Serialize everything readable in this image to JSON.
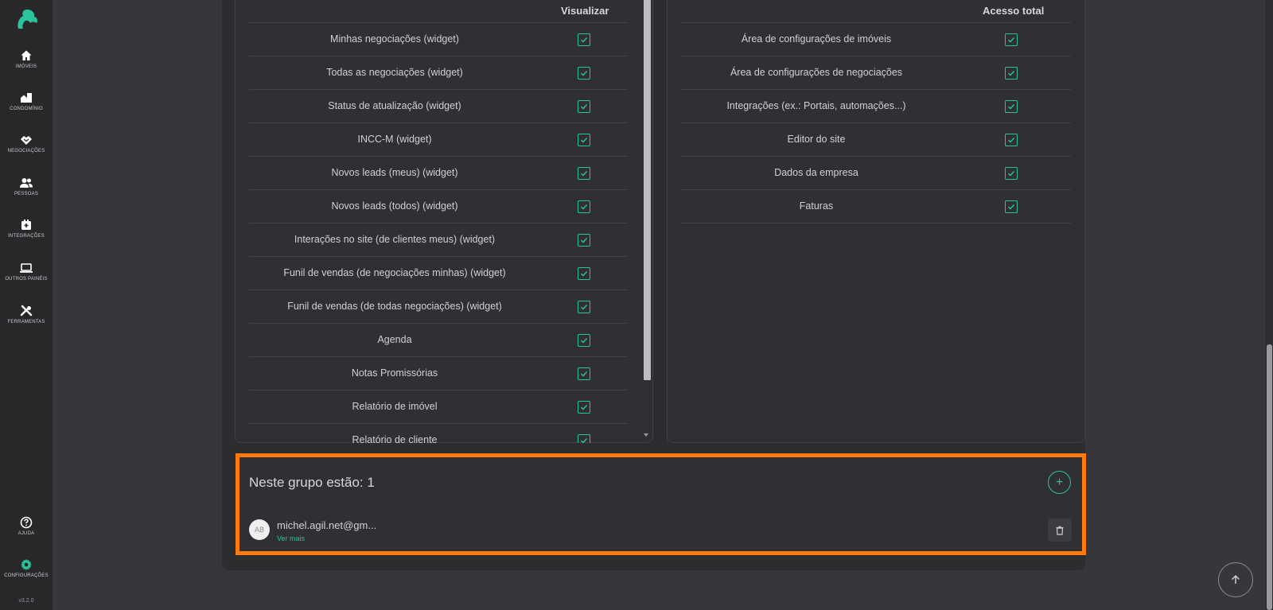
{
  "sidebar": {
    "items": [
      {
        "label": "IMÓVEIS",
        "icon": "home-icon"
      },
      {
        "label": "CONDOMÍNIO",
        "icon": "building-icon"
      },
      {
        "label": "NEGOCIAÇÕES",
        "icon": "handshake-icon"
      },
      {
        "label": "PESSOAS",
        "icon": "people-icon"
      },
      {
        "label": "INTEGRAÇÕES",
        "icon": "integrations-icon"
      },
      {
        "label": "OUTROS PAINÉIS",
        "icon": "laptop-icon"
      },
      {
        "label": "FERRAMENTAS",
        "icon": "tools-icon"
      }
    ],
    "help_label": "AJUDA",
    "settings_label": "CONFIGURAÇÕES",
    "version": "v3.2.0",
    "accent": "#2bc39b"
  },
  "left_card": {
    "column_header": "Visualizar",
    "rows": [
      "Minhas negociações (widget)",
      "Todas as negociações (widget)",
      "Status de atualização (widget)",
      "INCC-M (widget)",
      "Novos leads (meus) (widget)",
      "Novos leads (todos) (widget)",
      "Interações no site (de clientes meus) (widget)",
      "Funil de vendas (de negociações minhas) (widget)",
      "Funil de vendas (de todas negociações) (widget)",
      "Agenda",
      "Notas Promissórias",
      "Relatório de imóvel",
      "Relatório de cliente"
    ]
  },
  "right_card": {
    "column_header": "Acesso total",
    "rows": [
      "Área de configurações de imóveis",
      "Área de configurações de negociações",
      "Integrações (ex.: Portais, automações...)",
      "Editor do site",
      "Dados da empresa",
      "Faturas"
    ]
  },
  "group": {
    "title": "Neste grupo estão: 1",
    "add_symbol": "+",
    "members": [
      {
        "initials": "AB",
        "email": "michel.agil.net@gm...",
        "more_label": "Ver mais"
      }
    ],
    "highlight_color": "#ff7a0f"
  }
}
